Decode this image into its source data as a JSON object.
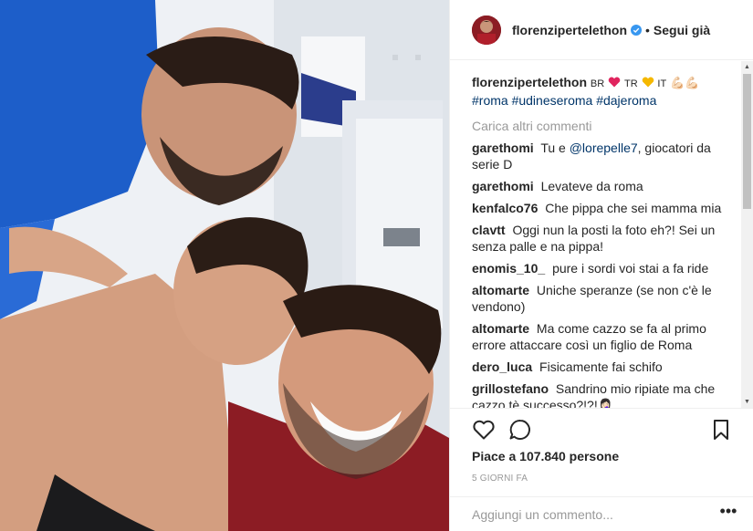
{
  "header": {
    "username": "florenzipertelethon",
    "separator": "•",
    "follow_label": "Segui già"
  },
  "caption": {
    "username": "florenzipertelethon",
    "text_1": "BR",
    "text_2": "TR",
    "text_3": "IT",
    "emojis": "💪🏻💪🏻",
    "hashtags": [
      "#roma",
      "#udineseroma",
      "#dajeroma"
    ]
  },
  "load_more_label": "Carica altri commenti",
  "comments": [
    {
      "user": "garethomi",
      "text": "Tu e",
      "mention": "@lorepelle7",
      "text2": ", giocatori da serie D"
    },
    {
      "user": "garethomi",
      "text": "Levateve da roma"
    },
    {
      "user": "kenfalco76",
      "text": "Che pippa che sei mamma mia"
    },
    {
      "user": "clavtt",
      "text": "Oggi nun la posti la foto eh?! Sei un senza palle e na pippa!"
    },
    {
      "user": "enomis_10_",
      "text": "pure i sordi voi stai a fa ride"
    },
    {
      "user": "altomarte",
      "text": "Uniche speranze (se non c'è le vendono)"
    },
    {
      "user": "altomarte",
      "text": "Ma come cazzo se fa al primo errore attaccare così un figlio de Roma"
    },
    {
      "user": "dero_luca",
      "text": "Fisicamente fai schifo"
    },
    {
      "user": "grillostefano",
      "text": "Sandrino mio ripiate ma che cazzo tè successo?!?!🤦🏻‍♀️"
    }
  ],
  "likes_text": "Piace a 107.840 persone",
  "time_text": "5 GIORNI FA",
  "add_comment_placeholder": "Aggiungi un commento...",
  "more_options": "•••",
  "icons": {
    "like": "heart-icon",
    "comment": "speech-bubble-icon",
    "save": "bookmark-icon",
    "verified": "verified-badge-icon"
  },
  "colors": {
    "accent_link": "#003569",
    "verified_blue": "#3897f0",
    "muted": "#999999",
    "heart_red": "#e0245e",
    "heart_yellow": "#f5b800"
  }
}
